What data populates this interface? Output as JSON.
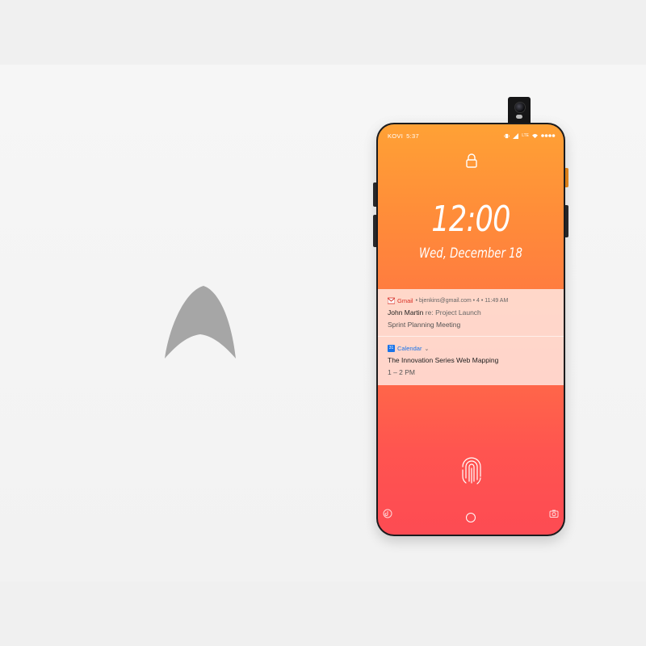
{
  "status_bar": {
    "carrier": "KOVI",
    "time": "5:37",
    "network": "LTE"
  },
  "lockscreen": {
    "clock": "12:00",
    "date": "Wed, December 18"
  },
  "notifications": [
    {
      "app": "Gmail",
      "meta": "• bjenkins@gmail.com • 4 • 11:49 AM",
      "sender": "John Martin",
      "subject": "re: Project Launch",
      "body": "Sprint Planning Meeting",
      "app_color": "#d93025"
    },
    {
      "app": "Calendar",
      "meta": "⌄",
      "icon_text": "31",
      "title": "The Innovation Series Web Mapping",
      "body": "1 – 2 PM",
      "app_color": "#1a73e8"
    }
  ],
  "icons": {
    "lock": "lock-icon",
    "fingerprint": "fingerprint-icon",
    "home": "home-circle-icon",
    "left_shortcut": "assistant-icon",
    "right_shortcut": "camera-icon",
    "brand": "brand-logo"
  },
  "colors": {
    "screen_top": "#ffa135",
    "screen_bottom": "#fd4b53",
    "logo": "#a6a6a6"
  }
}
